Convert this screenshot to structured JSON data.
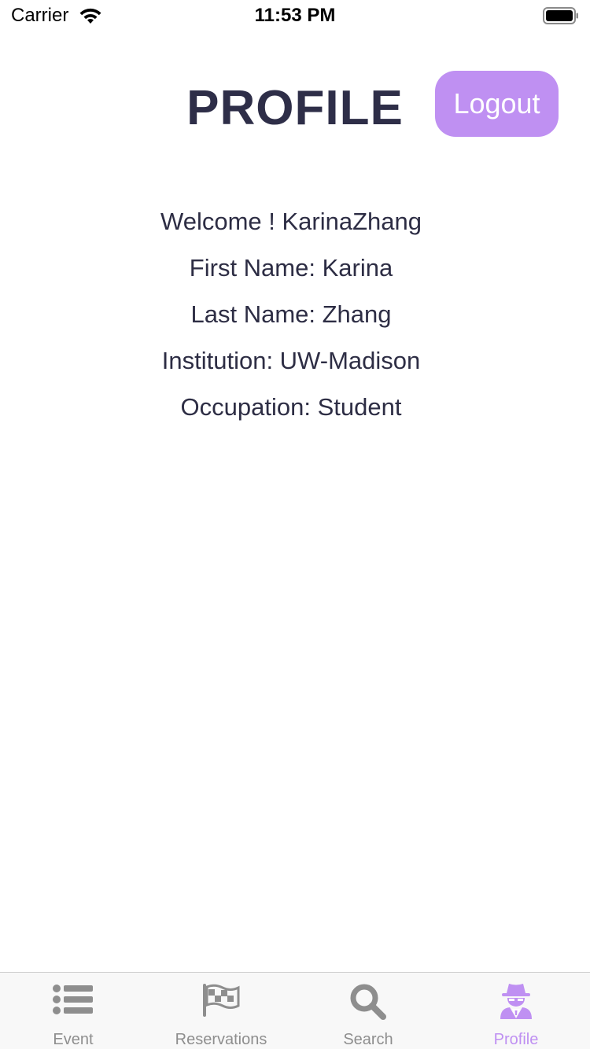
{
  "status_bar": {
    "carrier": "Carrier",
    "time": "11:53 PM"
  },
  "header": {
    "title": "PROFILE",
    "logout_label": "Logout"
  },
  "profile": {
    "welcome": "Welcome ! KarinaZhang",
    "first_name": "First Name: Karina",
    "last_name": "Last Name: Zhang",
    "institution": "Institution: UW-Madison",
    "occupation": "Occupation: Student"
  },
  "tabs": [
    {
      "label": "Event",
      "icon": "list-icon"
    },
    {
      "label": "Reservations",
      "icon": "flag-icon"
    },
    {
      "label": "Search",
      "icon": "search-icon"
    },
    {
      "label": "Profile",
      "icon": "user-secret-icon",
      "active": true
    }
  ],
  "colors": {
    "accent": "#bf90f2",
    "inactive": "#8e8e8e",
    "text": "#2d2d44"
  }
}
